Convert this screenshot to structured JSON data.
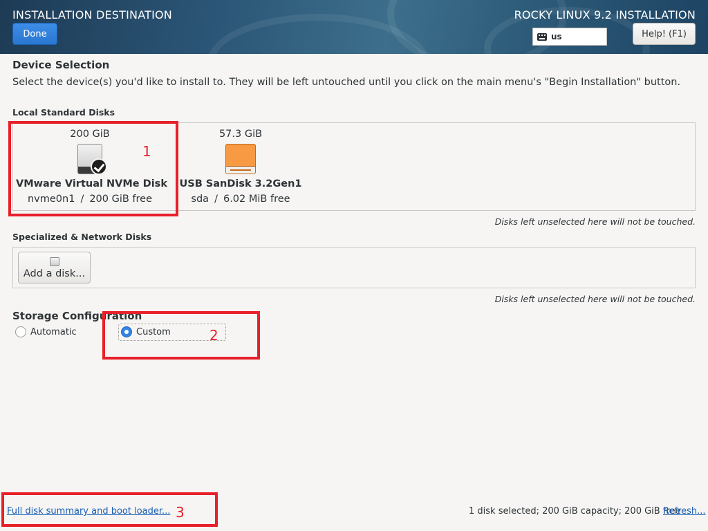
{
  "header": {
    "title": "INSTALLATION DESTINATION",
    "done_label": "Done",
    "product_title": "ROCKY LINUX 9.2 INSTALLATION",
    "keyboard_layout": "us",
    "help_label": "Help! (F1)"
  },
  "device_selection": {
    "heading": "Device Selection",
    "instructions": "Select the device(s) you'd like to install to.  They will be left untouched until you click on the main menu's \"Begin Installation\" button."
  },
  "local_disks": {
    "label": "Local Standard Disks",
    "note": "Disks left unselected here will not be touched.",
    "disks": [
      {
        "size": "200 GiB",
        "name": "VMware Virtual NVMe Disk",
        "device": "nvme0n1",
        "separator": "/",
        "free": "200 GiB free",
        "selected": true,
        "icon": "hard-disk-icon"
      },
      {
        "size": "57.3 GiB",
        "name": "USB SanDisk 3.2Gen1",
        "device": "sda",
        "separator": "/",
        "free": "6.02 MiB free",
        "selected": false,
        "icon": "usb-drive-icon"
      }
    ]
  },
  "network_disks": {
    "label": "Specialized & Network Disks",
    "add_disk_label": "Add a disk...",
    "note": "Disks left unselected here will not be touched."
  },
  "storage_configuration": {
    "heading": "Storage Configuration",
    "options": [
      {
        "label": "Automatic",
        "checked": false
      },
      {
        "label": "Custom",
        "checked": true
      }
    ]
  },
  "annotations": [
    "1",
    "2",
    "3"
  ],
  "footer": {
    "summary_link": "Full disk summary and boot loader...",
    "status": "1 disk selected; 200 GiB capacity; 200 GiB free",
    "refresh_link": "Refresh..."
  },
  "colors": {
    "accent": "#3584e4",
    "annotation": "#e8202a",
    "link": "#1a5fb4"
  }
}
